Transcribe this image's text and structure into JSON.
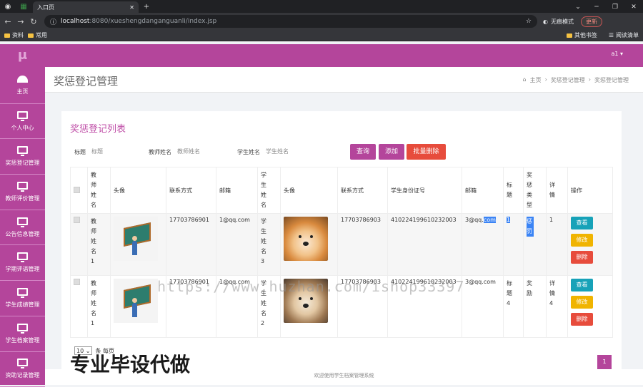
{
  "browser": {
    "tab_title": "入口页",
    "url_host": "localhost",
    "url_rest": ":8080/xueshengdanganguanli/index.jsp",
    "incognito": "无痕模式",
    "update": "更新",
    "bookmarks": [
      "资料",
      "常用"
    ],
    "other_bookmarks": "其他书签",
    "reading_list": "阅读清单"
  },
  "sidebar": {
    "logo": "μ",
    "items": [
      {
        "label": "主页",
        "icon": "gauge-icon"
      },
      {
        "label": "个人中心",
        "icon": "monitor-icon"
      },
      {
        "label": "奖惩登记管理",
        "icon": "monitor-icon"
      },
      {
        "label": "教师评价管理",
        "icon": "monitor-icon"
      },
      {
        "label": "公告信息管理",
        "icon": "monitor-icon"
      },
      {
        "label": "学期评语管理",
        "icon": "monitor-icon"
      },
      {
        "label": "学生成绩管理",
        "icon": "monitor-icon"
      },
      {
        "label": "学生档案管理",
        "icon": "monitor-icon"
      },
      {
        "label": "资助记录管理",
        "icon": "monitor-icon"
      }
    ]
  },
  "topbar": {
    "user": "a1 ▾"
  },
  "header": {
    "title": "奖惩登记管理",
    "breadcrumb": [
      "主页",
      "奖惩登记管理",
      "奖惩登记管理"
    ]
  },
  "card": {
    "title": "奖惩登记列表"
  },
  "filter": {
    "title_label": "标题",
    "title_ph": "标题",
    "teacher_label": "教师姓名",
    "teacher_ph": "教师姓名",
    "student_label": "学生姓名",
    "student_ph": "学生姓名"
  },
  "buttons": {
    "query": "查询",
    "add": "添加",
    "batch_delete": "批量删除"
  },
  "table": {
    "headers": [
      "教师姓名",
      "头像",
      "联系方式",
      "邮箱",
      "学生姓名",
      "头像",
      "联系方式",
      "学生身份证号",
      "邮箱",
      "标题",
      "奖惩类型",
      "详情",
      "操作"
    ],
    "rows": [
      {
        "teacher": "教师姓名1",
        "phone": "17703786901",
        "email": "1@qq.com",
        "student": "学生姓名3",
        "sphone": "17703786903",
        "idcard": "410224199610232003",
        "semail_a": "3@qq.",
        "semail_b": "com",
        "title": "1",
        "type": "惩罚",
        "detail": "1"
      },
      {
        "teacher": "教师姓名1",
        "phone": "17703786901",
        "email": "1@qq.com",
        "student": "学生姓名2",
        "sphone": "17703786903",
        "idcard": "410224199610232003",
        "semail_a": "3@qq.com",
        "semail_b": "",
        "title": "标题4",
        "type": "奖励",
        "detail": "详情4"
      }
    ],
    "ops": {
      "view": "查看",
      "edit": "修改",
      "del": "删除"
    }
  },
  "pager": {
    "size": "10",
    "suffix": "条 每页",
    "page": "1"
  },
  "footer": "欢迎使用学生档案管理系统",
  "watermark": "https://www.huzhan.com/ishop33397",
  "promo": "专业毕设代做"
}
